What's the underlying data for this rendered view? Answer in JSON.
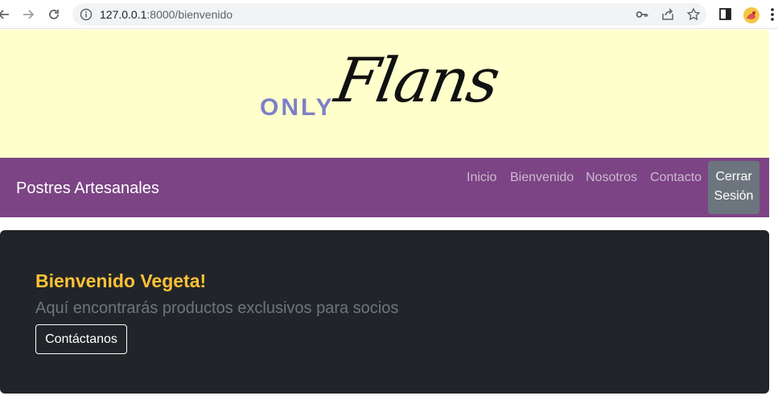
{
  "browser": {
    "url_host": "127.0.0.1",
    "url_path": ":8000/bienvenido",
    "icons": [
      "back-icon",
      "forward-icon",
      "reload-icon",
      "info-icon",
      "key-icon",
      "share-icon",
      "star-icon",
      "side-panel-icon",
      "profile-icon",
      "menu-icon"
    ]
  },
  "banner": {
    "logo_only": "ONLY",
    "logo_flans": "Flans",
    "background": "#ffffcc"
  },
  "navbar": {
    "brand": "Postres Artesanales",
    "links": [
      "Inicio",
      "Bienvenido",
      "Nosotros",
      "Contacto"
    ],
    "logout_line1": "Cerrar",
    "logout_line2": "Sesión",
    "background": "#7c4485"
  },
  "hero": {
    "title": "Bienvenido Vegeta!",
    "subtitle": "Aquí encontrarás productos exclusivos para socios",
    "button": "Contáctanos",
    "title_color": "#ffc136",
    "background": "#212529"
  }
}
